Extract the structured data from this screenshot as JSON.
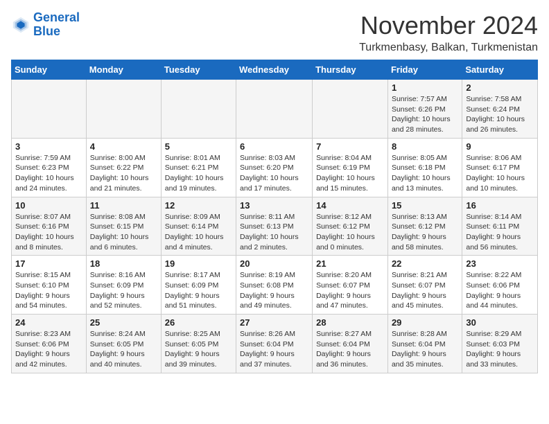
{
  "logo": {
    "line1": "General",
    "line2": "Blue"
  },
  "title": "November 2024",
  "subtitle": "Turkmenbasy, Balkan, Turkmenistan",
  "weekdays": [
    "Sunday",
    "Monday",
    "Tuesday",
    "Wednesday",
    "Thursday",
    "Friday",
    "Saturday"
  ],
  "weeks": [
    [
      {
        "day": "",
        "sunrise": "",
        "sunset": "",
        "daylight": ""
      },
      {
        "day": "",
        "sunrise": "",
        "sunset": "",
        "daylight": ""
      },
      {
        "day": "",
        "sunrise": "",
        "sunset": "",
        "daylight": ""
      },
      {
        "day": "",
        "sunrise": "",
        "sunset": "",
        "daylight": ""
      },
      {
        "day": "",
        "sunrise": "",
        "sunset": "",
        "daylight": ""
      },
      {
        "day": "1",
        "sunrise": "Sunrise: 7:57 AM",
        "sunset": "Sunset: 6:26 PM",
        "daylight": "Daylight: 10 hours and 28 minutes."
      },
      {
        "day": "2",
        "sunrise": "Sunrise: 7:58 AM",
        "sunset": "Sunset: 6:24 PM",
        "daylight": "Daylight: 10 hours and 26 minutes."
      }
    ],
    [
      {
        "day": "3",
        "sunrise": "Sunrise: 7:59 AM",
        "sunset": "Sunset: 6:23 PM",
        "daylight": "Daylight: 10 hours and 24 minutes."
      },
      {
        "day": "4",
        "sunrise": "Sunrise: 8:00 AM",
        "sunset": "Sunset: 6:22 PM",
        "daylight": "Daylight: 10 hours and 21 minutes."
      },
      {
        "day": "5",
        "sunrise": "Sunrise: 8:01 AM",
        "sunset": "Sunset: 6:21 PM",
        "daylight": "Daylight: 10 hours and 19 minutes."
      },
      {
        "day": "6",
        "sunrise": "Sunrise: 8:03 AM",
        "sunset": "Sunset: 6:20 PM",
        "daylight": "Daylight: 10 hours and 17 minutes."
      },
      {
        "day": "7",
        "sunrise": "Sunrise: 8:04 AM",
        "sunset": "Sunset: 6:19 PM",
        "daylight": "Daylight: 10 hours and 15 minutes."
      },
      {
        "day": "8",
        "sunrise": "Sunrise: 8:05 AM",
        "sunset": "Sunset: 6:18 PM",
        "daylight": "Daylight: 10 hours and 13 minutes."
      },
      {
        "day": "9",
        "sunrise": "Sunrise: 8:06 AM",
        "sunset": "Sunset: 6:17 PM",
        "daylight": "Daylight: 10 hours and 10 minutes."
      }
    ],
    [
      {
        "day": "10",
        "sunrise": "Sunrise: 8:07 AM",
        "sunset": "Sunset: 6:16 PM",
        "daylight": "Daylight: 10 hours and 8 minutes."
      },
      {
        "day": "11",
        "sunrise": "Sunrise: 8:08 AM",
        "sunset": "Sunset: 6:15 PM",
        "daylight": "Daylight: 10 hours and 6 minutes."
      },
      {
        "day": "12",
        "sunrise": "Sunrise: 8:09 AM",
        "sunset": "Sunset: 6:14 PM",
        "daylight": "Daylight: 10 hours and 4 minutes."
      },
      {
        "day": "13",
        "sunrise": "Sunrise: 8:11 AM",
        "sunset": "Sunset: 6:13 PM",
        "daylight": "Daylight: 10 hours and 2 minutes."
      },
      {
        "day": "14",
        "sunrise": "Sunrise: 8:12 AM",
        "sunset": "Sunset: 6:12 PM",
        "daylight": "Daylight: 10 hours and 0 minutes."
      },
      {
        "day": "15",
        "sunrise": "Sunrise: 8:13 AM",
        "sunset": "Sunset: 6:12 PM",
        "daylight": "Daylight: 9 hours and 58 minutes."
      },
      {
        "day": "16",
        "sunrise": "Sunrise: 8:14 AM",
        "sunset": "Sunset: 6:11 PM",
        "daylight": "Daylight: 9 hours and 56 minutes."
      }
    ],
    [
      {
        "day": "17",
        "sunrise": "Sunrise: 8:15 AM",
        "sunset": "Sunset: 6:10 PM",
        "daylight": "Daylight: 9 hours and 54 minutes."
      },
      {
        "day": "18",
        "sunrise": "Sunrise: 8:16 AM",
        "sunset": "Sunset: 6:09 PM",
        "daylight": "Daylight: 9 hours and 52 minutes."
      },
      {
        "day": "19",
        "sunrise": "Sunrise: 8:17 AM",
        "sunset": "Sunset: 6:09 PM",
        "daylight": "Daylight: 9 hours and 51 minutes."
      },
      {
        "day": "20",
        "sunrise": "Sunrise: 8:19 AM",
        "sunset": "Sunset: 6:08 PM",
        "daylight": "Daylight: 9 hours and 49 minutes."
      },
      {
        "day": "21",
        "sunrise": "Sunrise: 8:20 AM",
        "sunset": "Sunset: 6:07 PM",
        "daylight": "Daylight: 9 hours and 47 minutes."
      },
      {
        "day": "22",
        "sunrise": "Sunrise: 8:21 AM",
        "sunset": "Sunset: 6:07 PM",
        "daylight": "Daylight: 9 hours and 45 minutes."
      },
      {
        "day": "23",
        "sunrise": "Sunrise: 8:22 AM",
        "sunset": "Sunset: 6:06 PM",
        "daylight": "Daylight: 9 hours and 44 minutes."
      }
    ],
    [
      {
        "day": "24",
        "sunrise": "Sunrise: 8:23 AM",
        "sunset": "Sunset: 6:06 PM",
        "daylight": "Daylight: 9 hours and 42 minutes."
      },
      {
        "day": "25",
        "sunrise": "Sunrise: 8:24 AM",
        "sunset": "Sunset: 6:05 PM",
        "daylight": "Daylight: 9 hours and 40 minutes."
      },
      {
        "day": "26",
        "sunrise": "Sunrise: 8:25 AM",
        "sunset": "Sunset: 6:05 PM",
        "daylight": "Daylight: 9 hours and 39 minutes."
      },
      {
        "day": "27",
        "sunrise": "Sunrise: 8:26 AM",
        "sunset": "Sunset: 6:04 PM",
        "daylight": "Daylight: 9 hours and 37 minutes."
      },
      {
        "day": "28",
        "sunrise": "Sunrise: 8:27 AM",
        "sunset": "Sunset: 6:04 PM",
        "daylight": "Daylight: 9 hours and 36 minutes."
      },
      {
        "day": "29",
        "sunrise": "Sunrise: 8:28 AM",
        "sunset": "Sunset: 6:04 PM",
        "daylight": "Daylight: 9 hours and 35 minutes."
      },
      {
        "day": "30",
        "sunrise": "Sunrise: 8:29 AM",
        "sunset": "Sunset: 6:03 PM",
        "daylight": "Daylight: 9 hours and 33 minutes."
      }
    ]
  ]
}
